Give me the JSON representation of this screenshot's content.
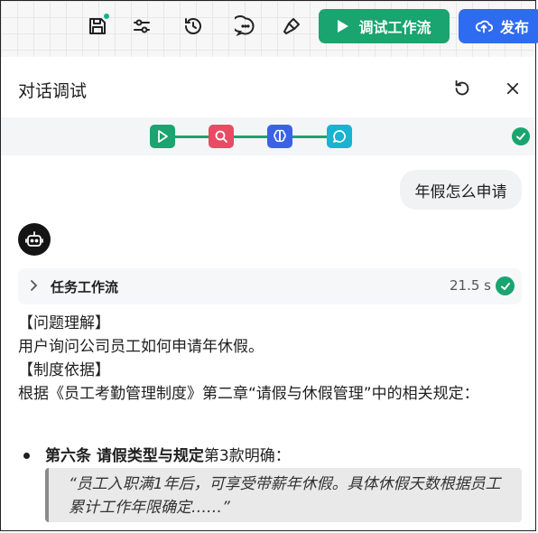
{
  "toolbar": {
    "debug_label": "调试工作流",
    "publish_label": "发布",
    "icons": [
      "save-icon",
      "settings-sliders-icon",
      "history-icon",
      "comment-dots-icon",
      "brush-icon",
      "play-icon",
      "cloud-upload-icon"
    ],
    "colors": {
      "debug": "#1aa46f",
      "publish": "#2f6bf0"
    }
  },
  "panel": {
    "title": "对话调试",
    "icons": [
      "reset-icon",
      "close-icon"
    ]
  },
  "flow": {
    "nodes": [
      {
        "name": "start-node",
        "icon": "play-icon",
        "color": "#1aa46f"
      },
      {
        "name": "search-node",
        "icon": "search-icon",
        "color": "#e84b64"
      },
      {
        "name": "llm-node",
        "icon": "brain-icon",
        "color": "#3b62e6"
      },
      {
        "name": "reply-node",
        "icon": "chat-icon",
        "color": "#19b2d1"
      }
    ],
    "status_icon": "check-icon"
  },
  "conversation": {
    "user_message": "年假怎么申请",
    "task": {
      "label": "任务工作流",
      "time": "21.5 s"
    },
    "answer": {
      "section1_title": "【问题理解】",
      "section1_text": "用户询问公司员工如何申请年休假。",
      "section2_title": "【制度依据】",
      "section2_text": "根据《员工考勤管理制度》第二章“请假与休假管理”中的相关规定：",
      "bullet_bold": "第六条 请假类型与规定",
      "bullet_rest": "第3款明确：",
      "quote": "“员工入职满1年后，可享受带薪年休假。具体休假天数根据员工累计工作年限确定……”"
    }
  }
}
